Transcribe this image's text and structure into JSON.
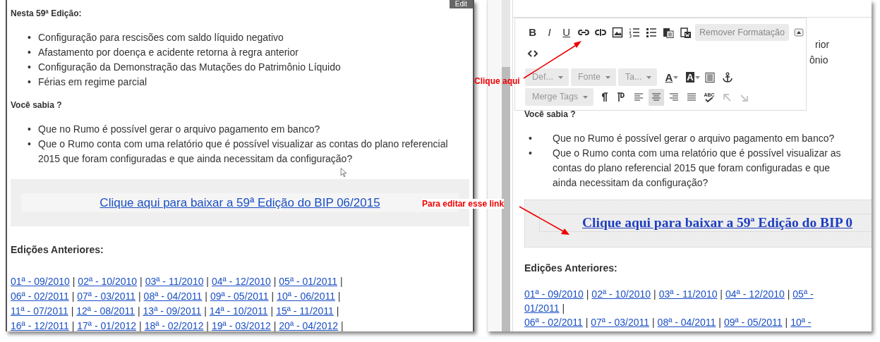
{
  "left_panel": {
    "edit_tab": "Edit",
    "heading_1": "Nesta 59ª Edição:",
    "list_1": [
      {
        "bullet": "•",
        "text": "Configuração para rescisões com saldo líquido negativo"
      },
      {
        "bullet": "•",
        "text": "Afastamento por doença e acidente retorna à regra anterior"
      },
      {
        "bullet": "•",
        "text": "Configuração da Demonstração das Mutações do Patrimônio Líquido"
      },
      {
        "bullet": "•",
        "text": "Férias em regime parcial"
      }
    ],
    "heading_2": "Você sabia ?",
    "list_2": [
      {
        "bullet": "•",
        "text": "Que no Rumo é possível gerar o arquivo pagamento em banco?"
      },
      {
        "bullet": "•",
        "text": "Que o Rumo conta com uma relatório que é possível visualizar as contas do plano referencial 2015 que foram configuradas e que ainda necessitam da configuração?"
      }
    ],
    "download_link": "Clique aqui para baixar a 59ª Edição do BIP 06/2015",
    "heading_3": "Edições Anteriores:",
    "editions": [
      [
        {
          "text": "01ª - 09/2010",
          "sep": "|"
        },
        {
          "text": "02ª - 10/2010",
          "sep": "|"
        },
        {
          "text": "03ª - 11/2010",
          "sep": "|"
        },
        {
          "text": "04ª - 12/2010",
          "sep": "|"
        },
        {
          "text": "05ª - 01/2011",
          "sep": "|"
        }
      ],
      [
        {
          "text": "06ª - 02/2011",
          "sep": "|"
        },
        {
          "text": "07ª - 03/2011",
          "sep": "|"
        },
        {
          "text": "08ª - 04/2011",
          "sep": "|"
        },
        {
          "text": "09ª - 05/2011",
          "sep": "|"
        },
        {
          "text": "10ª - 06/2011",
          "sep": "|"
        }
      ],
      [
        {
          "text": "11ª - 07/2011",
          "sep": "|"
        },
        {
          "text": "12ª - 08/2011",
          "sep": "|"
        },
        {
          "text": "13ª - 09/2011",
          "sep": "|"
        },
        {
          "text": "14ª - 10/2011",
          "sep": "|"
        },
        {
          "text": "15ª - 11/2011",
          "sep": "|"
        }
      ],
      [
        {
          "text": "16ª - 12/2011",
          "sep": "|"
        },
        {
          "text": "17ª - 01/2012",
          "sep": "|"
        },
        {
          "text": "18ª - 02/2012",
          "sep": "|"
        },
        {
          "text": "19ª - 03/2012",
          "sep": "|"
        },
        {
          "text": "20ª - 04/2012",
          "sep": "|"
        }
      ]
    ]
  },
  "right_panel": {
    "toolbar": [
      {
        "controls": [
          {
            "kind": "bold",
            "label": "B"
          },
          {
            "kind": "italic",
            "label": "I"
          },
          {
            "kind": "underline",
            "label": "U"
          },
          {
            "kind": "link"
          },
          {
            "kind": "unlink"
          },
          {
            "kind": "image"
          },
          {
            "kind": "numbered-list"
          },
          {
            "kind": "bullet-list"
          },
          {
            "kind": "paste"
          },
          {
            "kind": "paste-word"
          },
          {
            "kind": "button",
            "label": "Remover Formatação"
          },
          {
            "kind": "collapse"
          }
        ]
      },
      {
        "controls": [
          {
            "kind": "source"
          }
        ]
      },
      {
        "controls": [
          {
            "kind": "dropdown",
            "label": "Def..."
          },
          {
            "kind": "dropdown",
            "label": "Fonte"
          },
          {
            "kind": "dropdown",
            "label": "Ta..."
          },
          {
            "kind": "text-color",
            "label": "A"
          },
          {
            "kind": "bg-color",
            "label": "A"
          },
          {
            "kind": "block"
          },
          {
            "kind": "anchor"
          }
        ]
      },
      {
        "controls": [
          {
            "kind": "dropdown",
            "label": "Merge Tags"
          },
          {
            "kind": "paragraph-ltr"
          },
          {
            "kind": "paragraph-rtl"
          },
          {
            "kind": "align-left",
            "selected": false
          },
          {
            "kind": "align-center",
            "selected": true
          },
          {
            "kind": "align-right",
            "selected": false
          },
          {
            "kind": "justify",
            "selected": false
          },
          {
            "kind": "spellcheck",
            "label": "ABC"
          },
          {
            "kind": "undo",
            "disabled": true
          },
          {
            "kind": "redo",
            "disabled": true
          }
        ]
      }
    ],
    "hidden_fragments": [
      "rior",
      "ônio"
    ],
    "heading_2": "Você sabia ?",
    "list_2": [
      {
        "bullet": "•",
        "text": "Que no Rumo é possível gerar o arquivo pagamento em banco?"
      },
      {
        "bullet": "•",
        "text": "Que o Rumo conta com uma relatório que é possível visualizar as contas do plano referencial 2015 que foram configuradas e que ainda necessitam da configuração?"
      }
    ],
    "download_link": "Clique aqui para baixar a 59ª Edição do BIP 0",
    "heading_3": "Edições Anteriores:",
    "editions": [
      [
        {
          "text": "01ª - 09/2010",
          "sep": "|"
        },
        {
          "text": "02ª - 10/2010",
          "sep": "|"
        },
        {
          "text": "03ª - 11/2010",
          "sep": "|"
        },
        {
          "text": "04ª - 12/2010",
          "sep": "|"
        },
        {
          "text": "05ª -"
        }
      ],
      [
        {
          "text": "01/2011",
          "sep": "|"
        }
      ],
      [
        {
          "text": "06ª - 02/2011",
          "sep": "|"
        },
        {
          "text": "07ª - 03/2011",
          "sep": "|"
        },
        {
          "text": "08ª - 04/2011",
          "sep": "|"
        },
        {
          "text": "09ª - 05/2011",
          "sep": "|"
        },
        {
          "text": "10ª -"
        }
      ]
    ]
  },
  "annotations": [
    {
      "kind": "arrow-up",
      "text": "Clique aqui"
    },
    {
      "kind": "arrow-down",
      "text": "Para editar esse link"
    }
  ]
}
